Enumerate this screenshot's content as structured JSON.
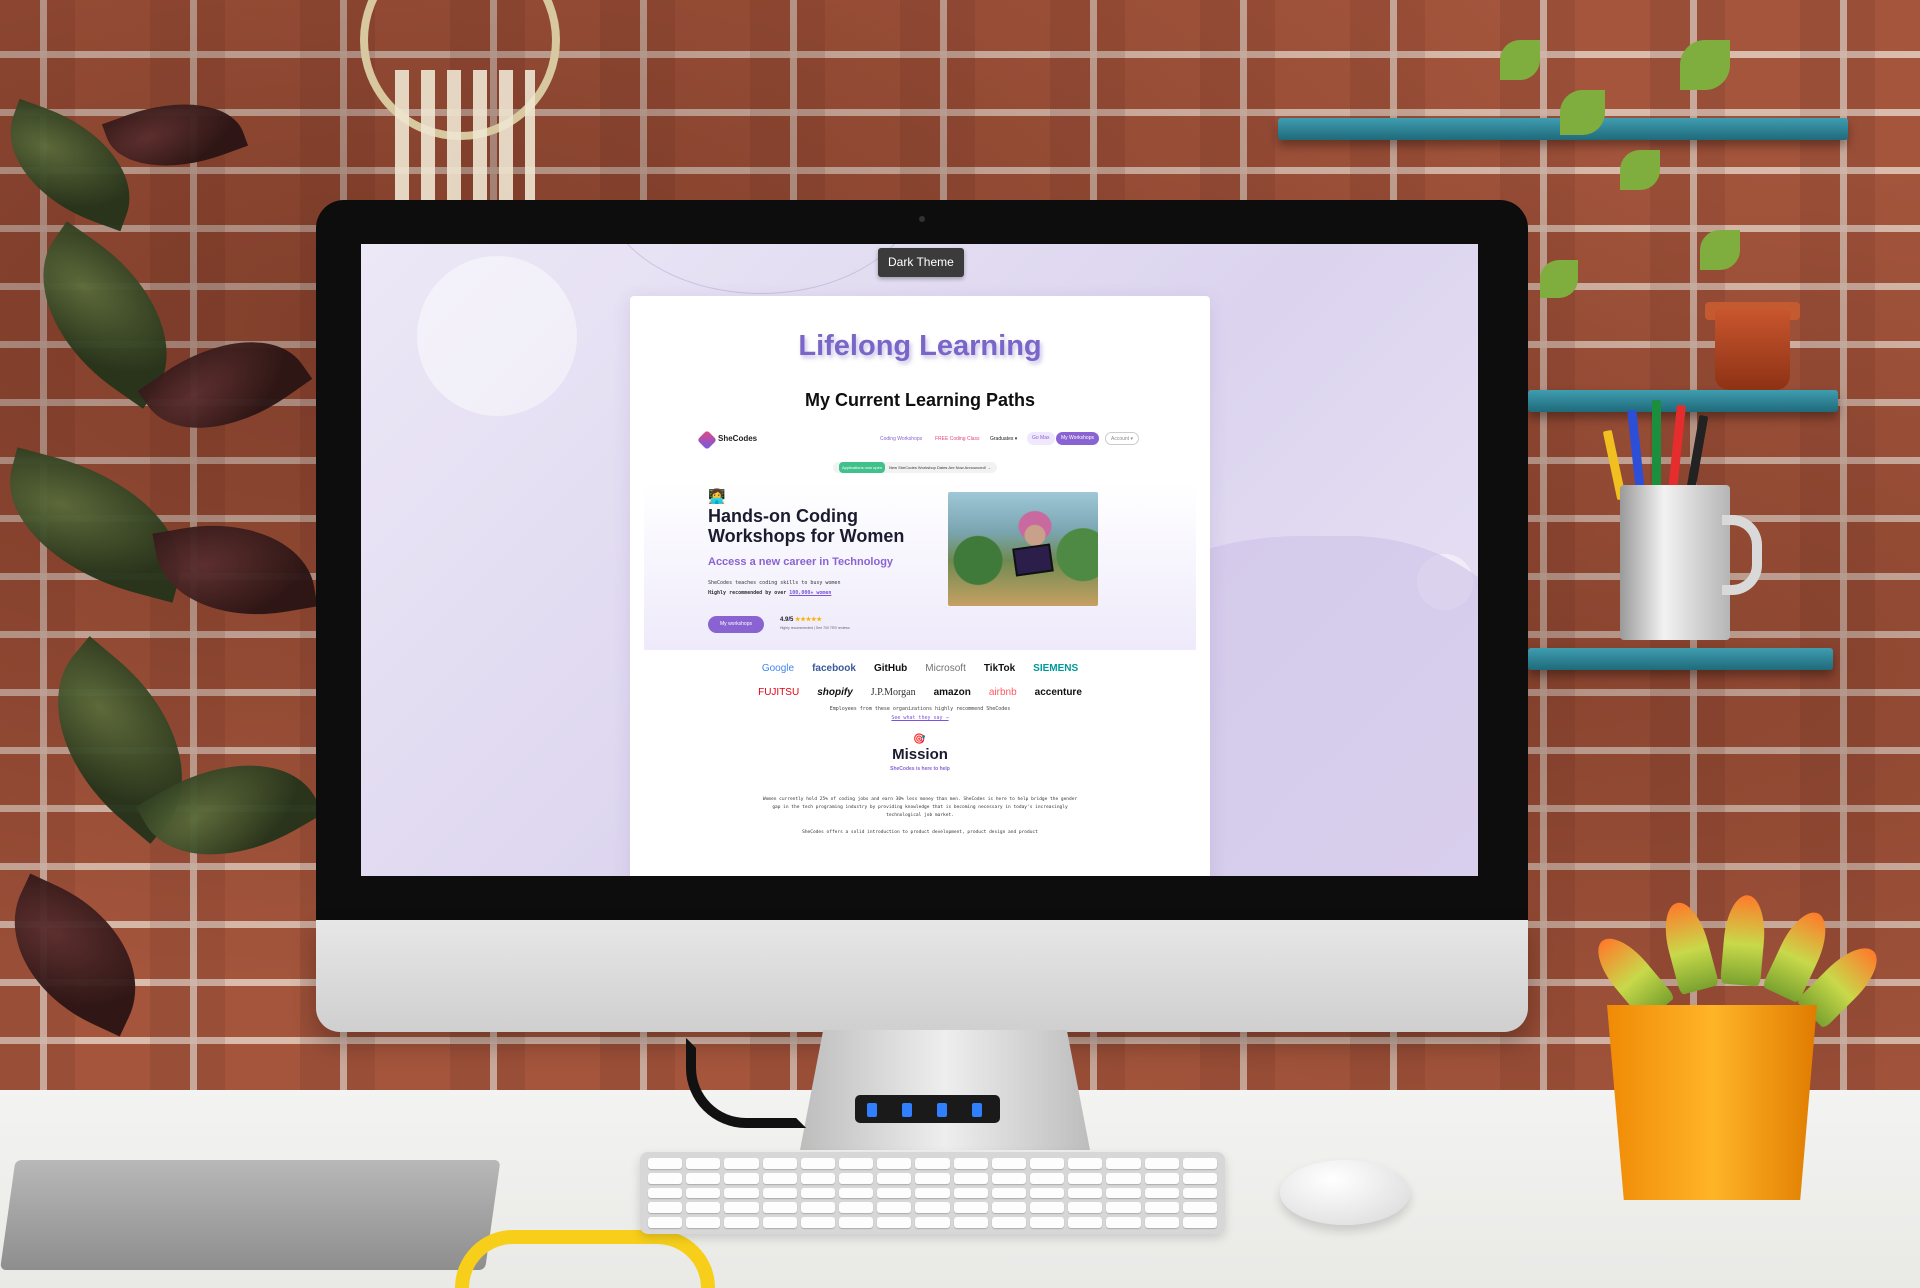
{
  "toolbar": {
    "theme_button": "Dark Theme"
  },
  "page": {
    "title": "Lifelong Learning",
    "subtitle": "My Current Learning Paths"
  },
  "site": {
    "logo": "SheCodes",
    "nav": [
      "Coding Workshops",
      "FREE Coding Class",
      "Graduates ▾",
      "Go Max",
      "My Workshops",
      "Account ▾"
    ],
    "announcement_badge": "Applications now open",
    "announcement_text": "New SheCodes Workshop Dates Are Now Announced!",
    "hero": {
      "emoji": "👩‍💻",
      "title": "Hands-on Coding Workshops for Women",
      "tagline": "Access a new career in Technology",
      "line1": "SheCodes teaches coding skills to busy women",
      "line2_prefix": "Highly recommended by over ",
      "line2_link": "100,000+ women",
      "button": "My workshops",
      "rating": "4.9/5",
      "stars": "★★★★★",
      "rating_sub": "Highly recommended | See 700 TRS reviews"
    },
    "logos_row1": [
      "Google",
      "facebook",
      "GitHub",
      "Microsoft",
      "TikTok",
      "SIEMENS"
    ],
    "logos_row2": [
      "FUJITSU",
      "shopify",
      "J.P.Morgan",
      "amazon",
      "airbnb",
      "accenture"
    ],
    "employees_text": "Employees from these organizations highly recommend SheCodes",
    "employees_link": "See what they say →",
    "mission": {
      "title": "Mission",
      "subtitle": "SheCodes is here to help",
      "text": "Women currently hold 25% of coding jobs and earn 30% less money than men. SheCodes is here to help bridge the gender gap in the tech programing industry by providing knowledge that is becoming necessary in today's increasingly technological job market.",
      "text2": "SheCodes offers a solid introduction to product development, product design and product"
    }
  },
  "colors": {
    "brand_purple": "#8a63d2",
    "title_purple": "#7a66c8",
    "screen_bg": "#e4ddf2"
  }
}
